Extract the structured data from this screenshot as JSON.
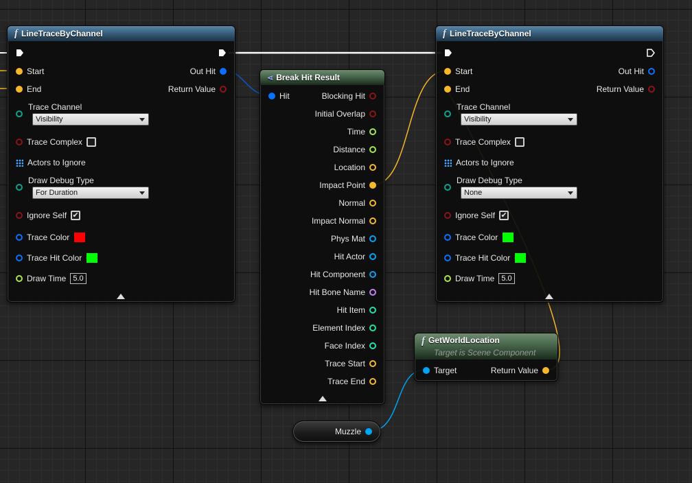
{
  "colors": {
    "exec": "#ffffff",
    "vector": "#f5b82a",
    "bool": "#8c1419",
    "byte": "#0aa58a",
    "struct": "#0b6fff",
    "object": "#00a4f5",
    "float": "#a9e648",
    "name": "#c482f6",
    "int": "#1de2ac",
    "reference": "#0f57c4"
  },
  "trace_left": {
    "title": "LineTraceByChannel",
    "inputs": {
      "start": "Start",
      "end": "End",
      "trace_channel_label": "Trace Channel",
      "trace_channel_value": "Visibility",
      "trace_complex": "Trace Complex",
      "actors_to_ignore": "Actors to Ignore",
      "draw_debug_type_label": "Draw Debug Type",
      "draw_debug_type_value": "For Duration",
      "ignore_self": "Ignore Self",
      "trace_color": "Trace Color",
      "trace_hit_color": "Trace Hit Color",
      "draw_time": "Draw Time",
      "draw_time_value": "5.0"
    },
    "outputs": {
      "out_hit": "Out Hit",
      "return_value": "Return Value"
    },
    "trace_complex_checked": false,
    "ignore_self_checked": true,
    "trace_color_swatch": "#ff0000",
    "trace_hit_color_swatch": "#00ff00"
  },
  "break_hit": {
    "title": "Break Hit Result",
    "input": "Hit",
    "outputs": [
      {
        "label": "Blocking Hit",
        "type": "bool"
      },
      {
        "label": "Initial Overlap",
        "type": "bool"
      },
      {
        "label": "Time",
        "type": "float"
      },
      {
        "label": "Distance",
        "type": "float"
      },
      {
        "label": "Location",
        "type": "vector"
      },
      {
        "label": "Impact Point",
        "type": "vector",
        "connected": true
      },
      {
        "label": "Normal",
        "type": "vector"
      },
      {
        "label": "Impact Normal",
        "type": "vector"
      },
      {
        "label": "Phys Mat",
        "type": "object"
      },
      {
        "label": "Hit Actor",
        "type": "object"
      },
      {
        "label": "Hit Component",
        "type": "object"
      },
      {
        "label": "Hit Bone Name",
        "type": "name"
      },
      {
        "label": "Hit Item",
        "type": "int"
      },
      {
        "label": "Element Index",
        "type": "int"
      },
      {
        "label": "Face Index",
        "type": "int"
      },
      {
        "label": "Trace Start",
        "type": "vector"
      },
      {
        "label": "Trace End",
        "type": "vector"
      }
    ]
  },
  "trace_right": {
    "title": "LineTraceByChannel",
    "inputs": {
      "start": "Start",
      "end": "End",
      "trace_channel_label": "Trace Channel",
      "trace_channel_value": "Visibility",
      "trace_complex": "Trace Complex",
      "actors_to_ignore": "Actors to Ignore",
      "draw_debug_type_label": "Draw Debug Type",
      "draw_debug_type_value": "None",
      "ignore_self": "Ignore Self",
      "trace_color": "Trace Color",
      "trace_hit_color": "Trace Hit Color",
      "draw_time": "Draw Time",
      "draw_time_value": "5.0"
    },
    "outputs": {
      "out_hit": "Out Hit",
      "return_value": "Return Value"
    },
    "trace_complex_checked": false,
    "ignore_self_checked": true,
    "trace_color_swatch": "#00ff00",
    "trace_hit_color_swatch": "#00ff00"
  },
  "get_world_location": {
    "title": "GetWorldLocation",
    "subtitle": "Target is Scene Component",
    "input": "Target",
    "output": "Return Value"
  },
  "muzzle": {
    "label": "Muzzle"
  },
  "icons": {
    "function": "function-f-icon",
    "break": "break-struct-icon",
    "array": "array-grid-icon",
    "collapse": "collapse-arrow-icon",
    "exec": "exec-pin-icon"
  }
}
